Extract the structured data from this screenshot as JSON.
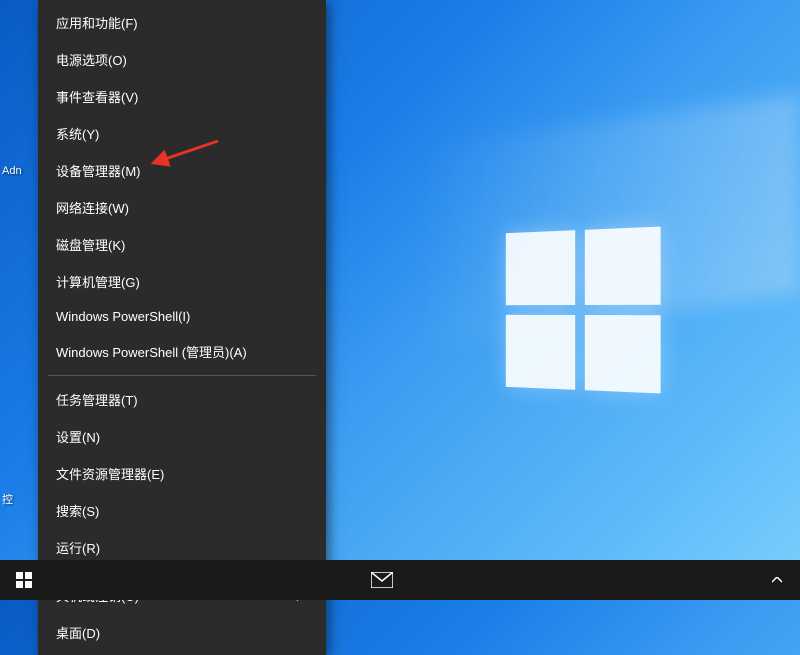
{
  "desktop": {
    "icon_labels": {
      "admin": "Adn",
      "control": "控"
    }
  },
  "context_menu": {
    "items": [
      {
        "label": "应用和功能(F)"
      },
      {
        "label": "电源选项(O)"
      },
      {
        "label": "事件查看器(V)"
      },
      {
        "label": "系统(Y)"
      },
      {
        "label": "设备管理器(M)"
      },
      {
        "label": "网络连接(W)"
      },
      {
        "label": "磁盘管理(K)"
      },
      {
        "label": "计算机管理(G)"
      },
      {
        "label": "Windows PowerShell(I)"
      },
      {
        "label": "Windows PowerShell (管理员)(A)"
      }
    ],
    "items2": [
      {
        "label": "任务管理器(T)"
      },
      {
        "label": "设置(N)"
      },
      {
        "label": "文件资源管理器(E)"
      },
      {
        "label": "搜索(S)"
      },
      {
        "label": "运行(R)"
      }
    ],
    "items3": [
      {
        "label": "关机或注销(U)",
        "submenu": true
      },
      {
        "label": "桌面(D)"
      }
    ]
  },
  "annotation": {
    "type": "arrow",
    "color": "#e73323",
    "points_to": "设备管理器(M)"
  }
}
